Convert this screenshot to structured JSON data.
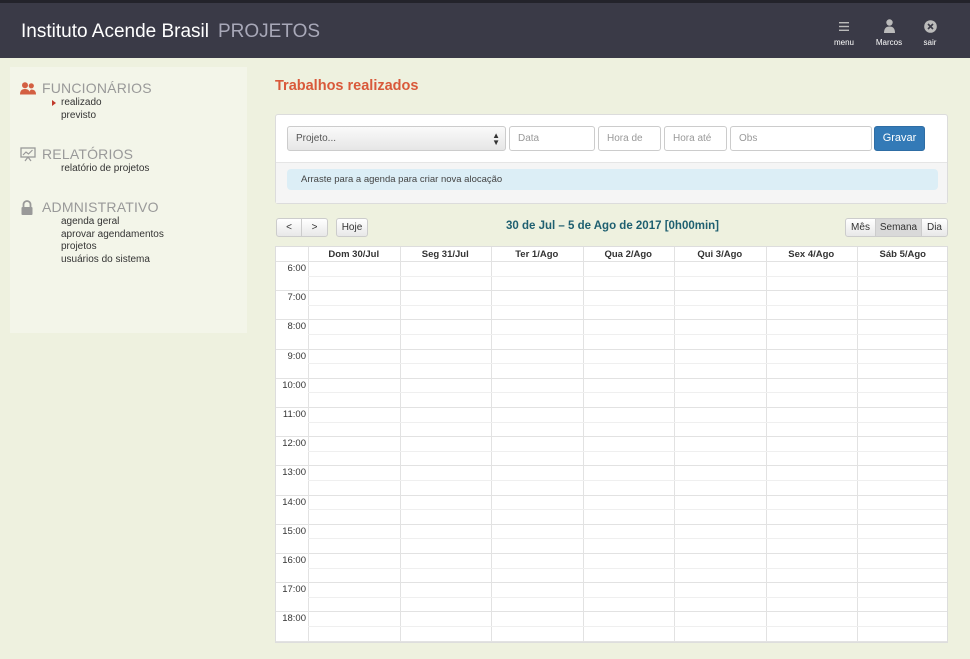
{
  "app": {
    "brand": "Instituto Acende Brasil",
    "module": "PROJETOS"
  },
  "navbar": {
    "menu_label": "menu",
    "user_label": "Marcos",
    "logout_label": "sair"
  },
  "sidebar": {
    "sections": [
      {
        "title": "FUNCIONÁRIOS",
        "icon": "users-icon",
        "items": [
          "realizado",
          "previsto"
        ]
      },
      {
        "title": "RELATÓRIOS",
        "icon": "chart-icon",
        "items": [
          "relatório de projetos"
        ]
      },
      {
        "title": "ADMNISTRATIVO",
        "icon": "lock-icon",
        "items": [
          "agenda geral",
          "aprovar agendamentos",
          "projetos",
          "usuários do sistema"
        ]
      }
    ]
  },
  "main": {
    "title": "Trabalhos realizados",
    "form": {
      "project_select": "Projeto...",
      "date_placeholder": "Data",
      "from_placeholder": "Hora de",
      "to_placeholder": "Hora até",
      "obs_placeholder": "Obs",
      "save_label": "Gravar",
      "hint": "Arraste para a agenda para criar nova alocação"
    },
    "calendar": {
      "prev_label": "<",
      "next_label": ">",
      "today_label": "Hoje",
      "title": "30 de Jul – 5 de Ago de 2017 [0h00min]",
      "views": [
        "Mês",
        "Semana",
        "Dia"
      ],
      "active_view": "Semana",
      "days": [
        "Dom 30/Jul",
        "Seg 31/Jul",
        "Ter 1/Ago",
        "Qua 2/Ago",
        "Qui 3/Ago",
        "Sex 4/Ago",
        "Sáb 5/Ago"
      ],
      "hours": [
        "6:00",
        "7:00",
        "8:00",
        "9:00",
        "10:00",
        "11:00",
        "12:00",
        "13:00",
        "14:00",
        "15:00",
        "16:00",
        "17:00",
        "18:00"
      ]
    }
  }
}
